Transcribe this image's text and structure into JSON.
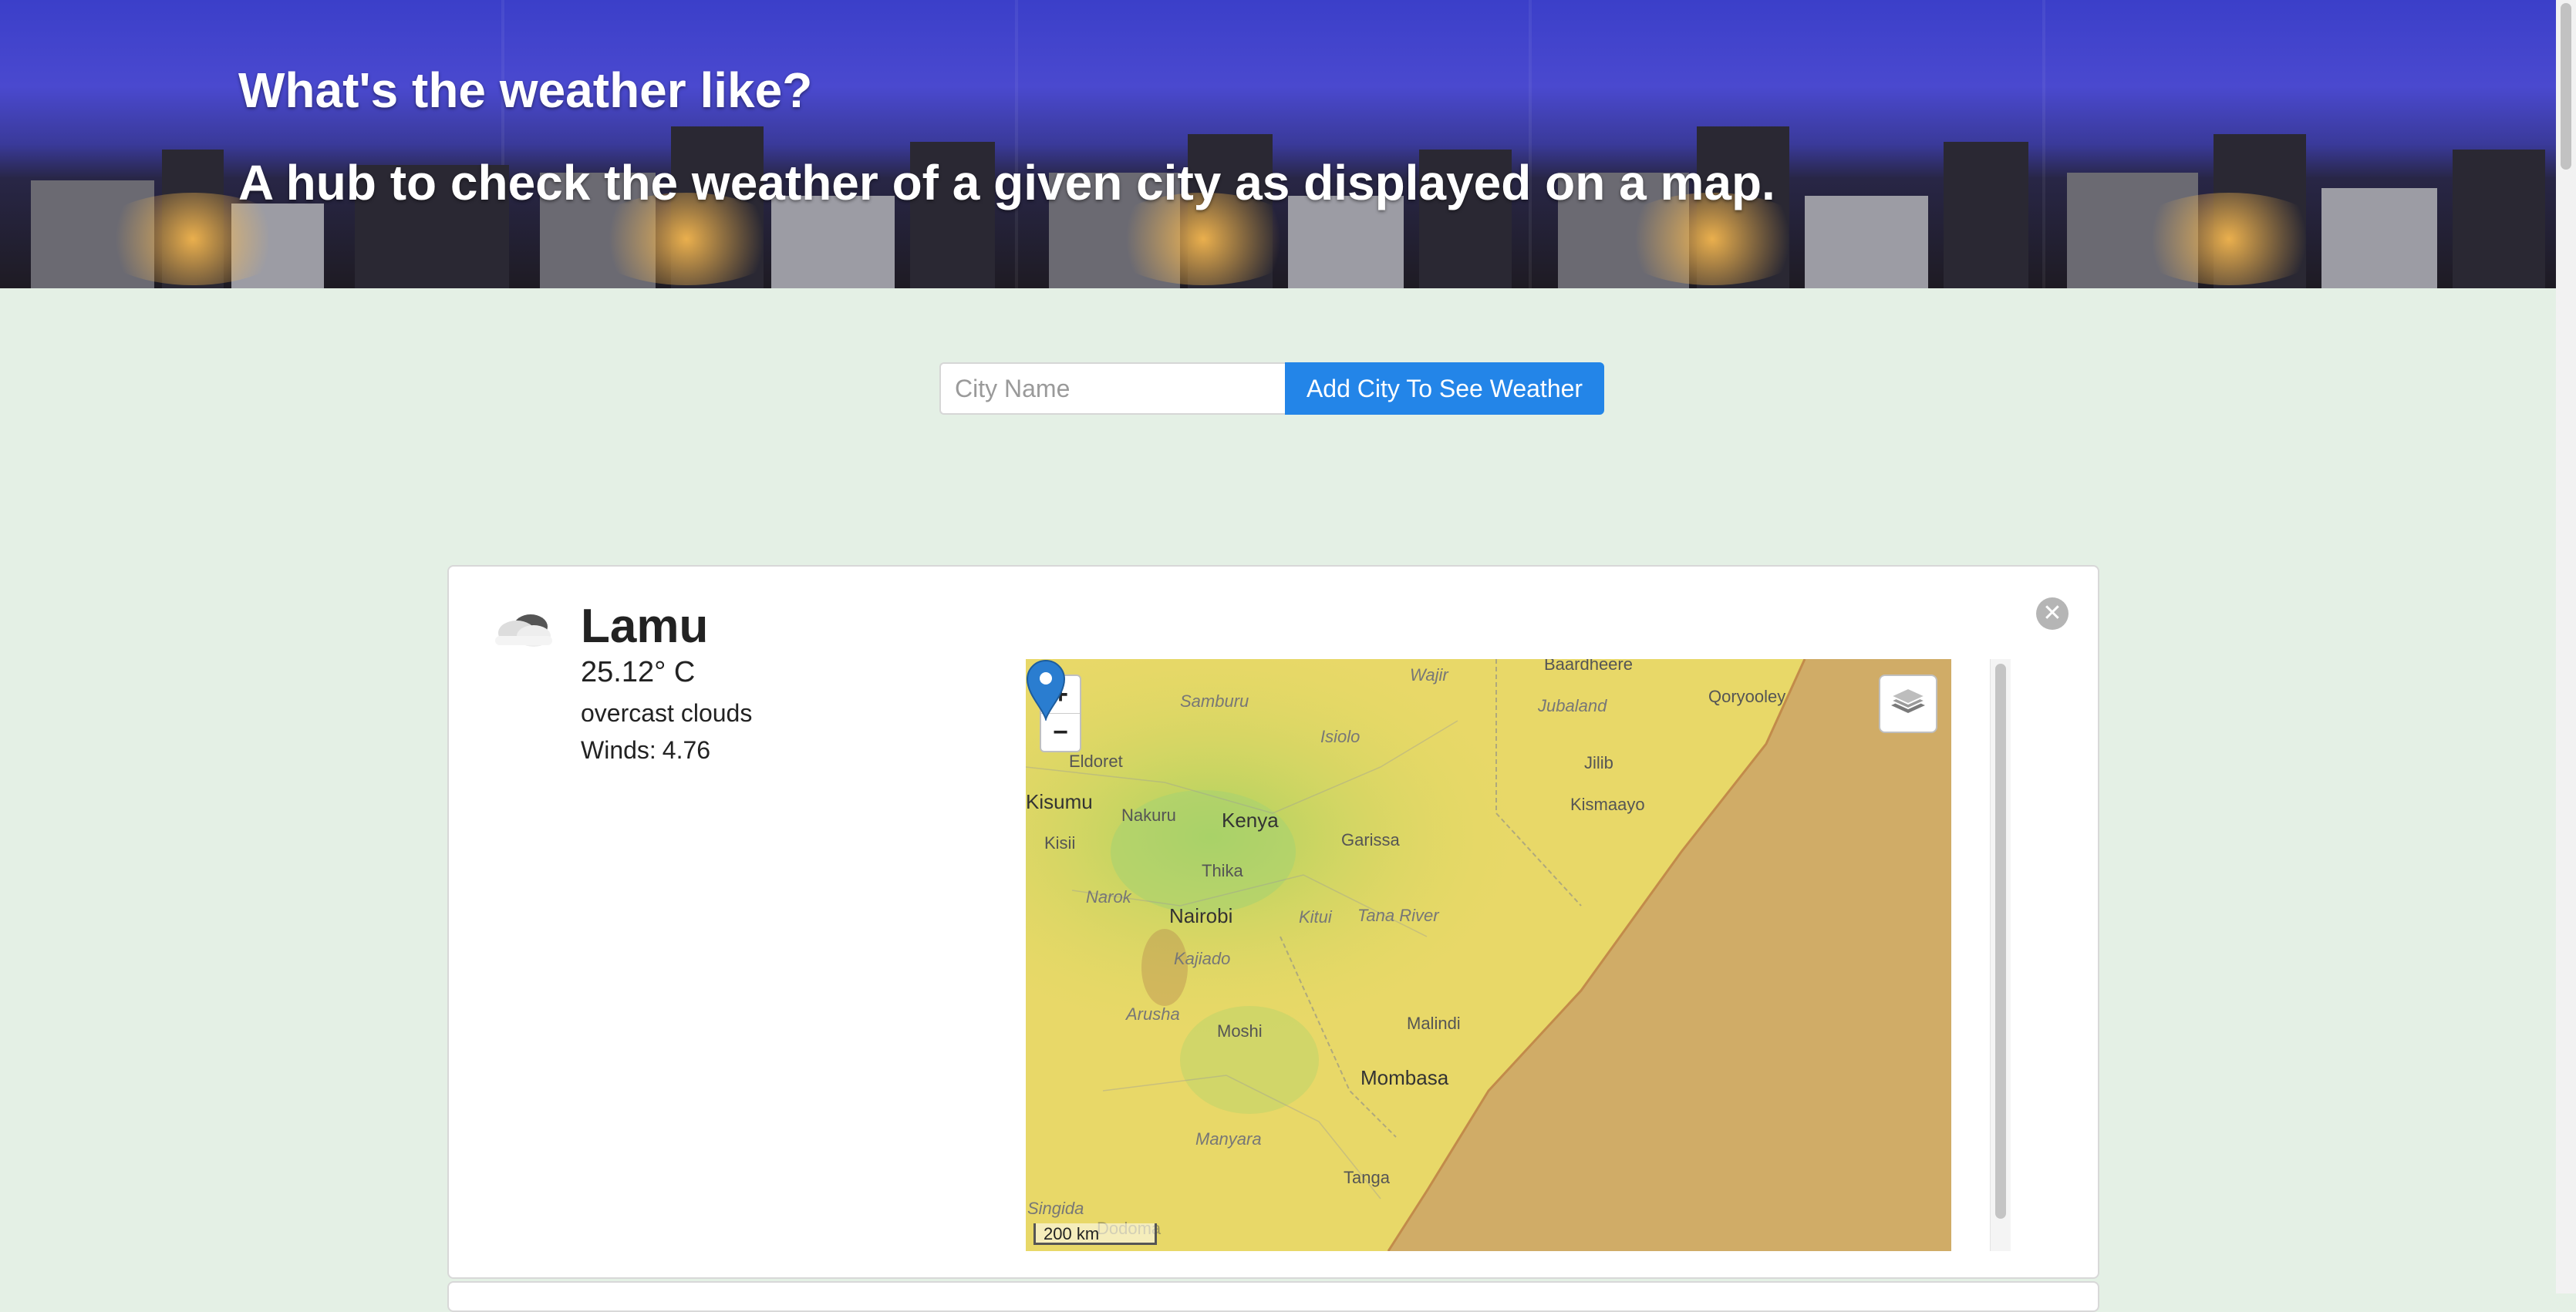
{
  "hero": {
    "title": "What's the weather like?",
    "subtitle": "A hub to check the weather of a given city as displayed on a map."
  },
  "form": {
    "city_placeholder": "City Name",
    "add_button": "Add City To See Weather"
  },
  "card": {
    "icon": "cloud-icon",
    "city": "Lamu",
    "temperature": "25.12° C",
    "description": "overcast clouds",
    "winds_label": "Winds:",
    "winds_value": "4.76"
  },
  "map": {
    "zoom_in": "+",
    "zoom_out": "−",
    "scale": "200 km",
    "labels": [
      "Wajir",
      "Samburu",
      "Baardheere",
      "Jubaland",
      "Qoryooley",
      "Isiolo",
      "Eldoret",
      "Kisumu",
      "Nakuru",
      "Kenya",
      "Jilib",
      "Kismaayo",
      "Kisii",
      "Garissa",
      "Thika",
      "Narok",
      "Nairobi",
      "Kitui",
      "Tana River",
      "Kajiado",
      "Arusha",
      "Moshi",
      "Malindi",
      "Mombasa",
      "Manyara",
      "Tanga",
      "Singida",
      "Dodoma"
    ]
  },
  "colors": {
    "page_bg": "#e4f0e5",
    "button": "#2385e8",
    "marker": "#2a7dd0"
  }
}
